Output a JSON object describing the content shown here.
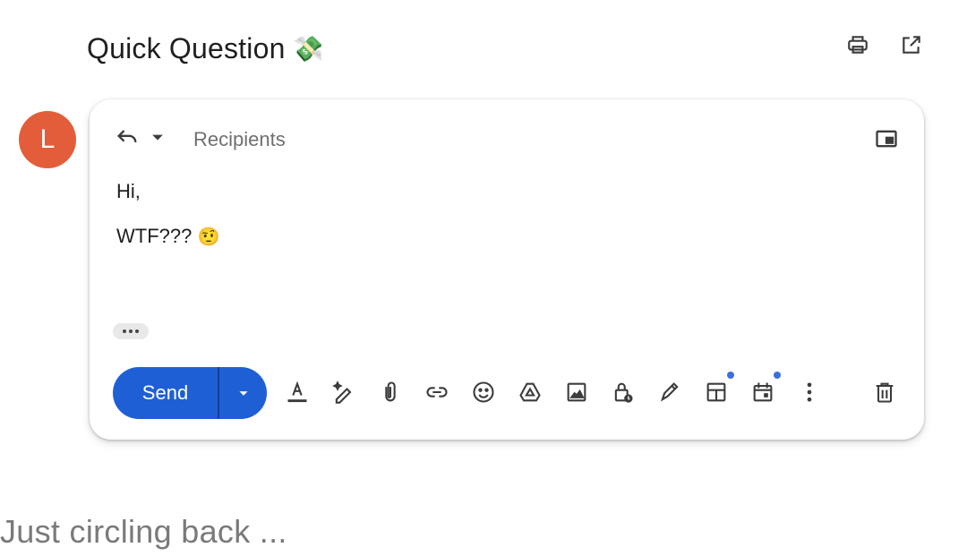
{
  "subject": {
    "text": "Quick Question",
    "emoji": "💸"
  },
  "avatar": {
    "initial": "L",
    "color": "#e35d3b"
  },
  "compose": {
    "recipients_placeholder": "Recipients",
    "body_line1": "Hi,",
    "body_line2_text": "WTF???",
    "body_line2_emoji": "🤨",
    "send_label": "Send"
  },
  "colors": {
    "send_blue": "#1f5fd6",
    "badge_dot": "#3b6fdc",
    "icon": "#3c3c3c"
  },
  "icons": {
    "top": [
      "print-icon",
      "open-in-new-window-icon"
    ],
    "toolbar": [
      "text-format-icon",
      "help-me-write-icon",
      "attach-icon",
      "link-icon",
      "emoji-icon",
      "drive-icon",
      "photo-icon",
      "confidential-mode-icon",
      "signature-icon",
      "layouts-icon",
      "schedule-event-icon",
      "more-options-icon",
      "delete-icon"
    ]
  },
  "snippet": "Just circling back ..."
}
